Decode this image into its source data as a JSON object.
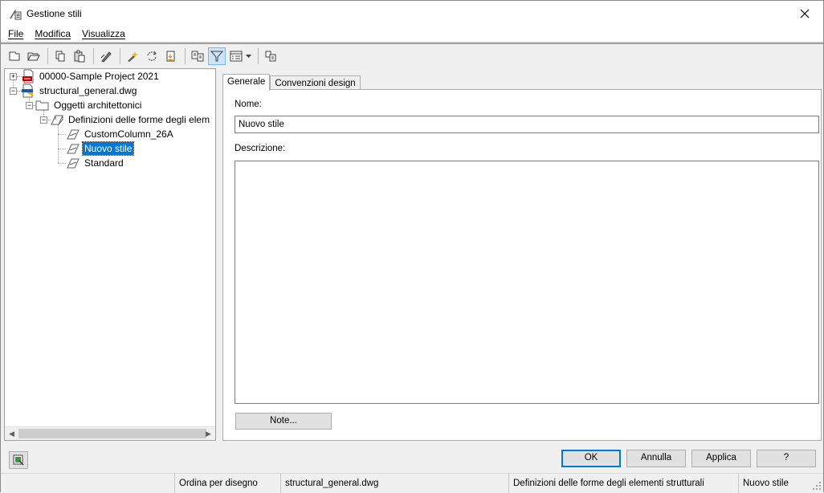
{
  "window": {
    "title": "Gestione stili"
  },
  "menu": [
    "File",
    "Modifica",
    "Visualizza"
  ],
  "toolbar": {
    "icons": [
      "new-icon",
      "open-icon",
      "copy-icon",
      "paste-icon",
      "edit-icon",
      "purge-icon",
      "synchronize-icon",
      "update-icon",
      "toggle-view-icon",
      "filter-icon",
      "view-list-icon",
      "inherit-icon"
    ]
  },
  "tree": {
    "nodes": [
      {
        "label": "00000-Sample Project 2021"
      },
      {
        "label": "structural_general.dwg"
      },
      {
        "label": "Oggetti architettonici"
      },
      {
        "label": "Definizioni delle forme degli elem"
      },
      {
        "label": "CustomColumn_26A"
      },
      {
        "label": "Nuovo stile"
      },
      {
        "label": "Standard"
      }
    ]
  },
  "tabs": [
    {
      "label": "Generale"
    },
    {
      "label": "Convenzioni design"
    }
  ],
  "form": {
    "name_label": "Nome:",
    "name_value": "Nuovo stile",
    "description_label": "Descrizione:",
    "description_value": "",
    "notes_button": "Note..."
  },
  "buttons": {
    "ok": "OK",
    "cancel": "Annulla",
    "apply": "Applica",
    "help": "?"
  },
  "status": {
    "sort": "Ordina per disegno",
    "drawing": "structural_general.dwg",
    "category": "Definizioni delle forme degli elementi strutturali",
    "style": "Nuovo stile"
  },
  "colors": {
    "selection": "#0078d7",
    "default_border": "#0078d7"
  }
}
